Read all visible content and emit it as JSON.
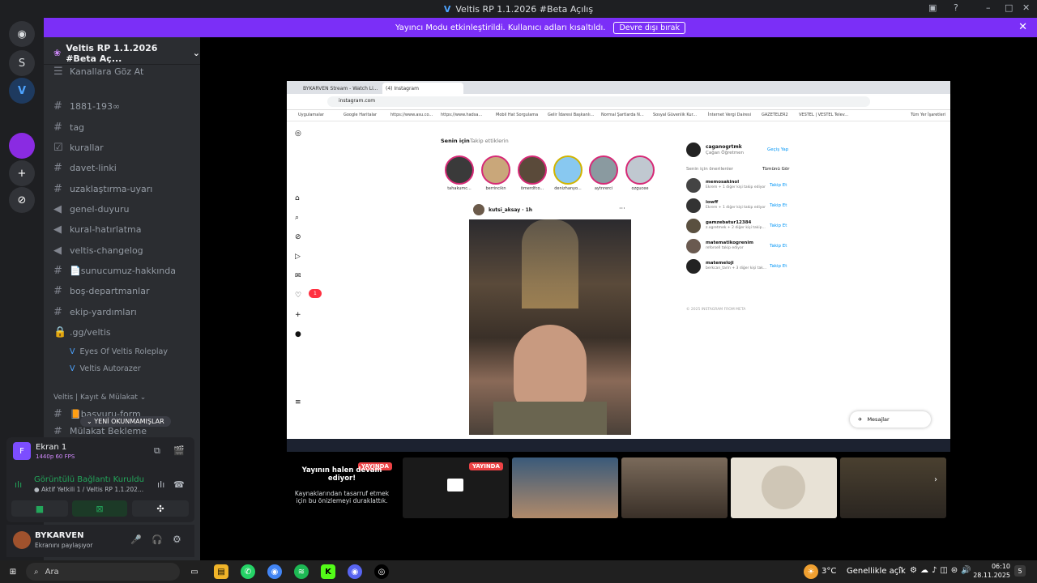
{
  "window": {
    "title": "Veltis RP 1.1.2026 #Beta Açılış"
  },
  "banner": {
    "text": "Yayıncı Modu etkinleştirildi. Kullanıcı adları kısaltıldı.",
    "button": "Devre dışı bırak"
  },
  "server": {
    "name": "Veltis RP 1.1.2026 #Beta Aç...",
    "browse": "Kanallara Göz At"
  },
  "channels": [
    "1881-193∞",
    "tag",
    "kurallar",
    "davet-linki",
    "uzaklaştırma-uyarı",
    "genel-duyuru",
    "kural-hatırlatma",
    "veltis-changelog",
    "📄sunucumuz-hakkında",
    "boş-departmanlar",
    "ekip-yardımları",
    ".gg/veltis"
  ],
  "threads": [
    "Eyes Of Veltis Roleplay",
    "Veltis Autorazer"
  ],
  "category": "Veltis | Kayıt & Mülakat",
  "cat_channels": [
    "📙başvuru-form",
    "Mülakat Bekleme"
  ],
  "unread_pill": "YENİ OKUNMAMIŞLAR",
  "screen": {
    "name": "Ekran 1",
    "quality": "1440p 60 FPS"
  },
  "voice": {
    "status": "Görüntülü Bağlantı Kuruldu",
    "channel": "Aktif Yetkili 1 / Veltis RP 1.1.202..."
  },
  "user": {
    "name": "BYKARVEN",
    "status": "Ekranını paylaşıyor"
  },
  "browser": {
    "tab1": "BYKARVEN Stream - Watch Li...",
    "tab2": "(4) Instagram",
    "url": "instagram.com",
    "bookmarks": [
      "Uygulamalar",
      "Google Haritalar",
      "https://www.asu.co...",
      "https://www.hadsa...",
      "Mobil Hat Sorgulama",
      "Gelir İdaresi Başkanlı...",
      "Normal Şartlarda N...",
      "Sosyal Güvenlik Kur...",
      "İnternet Vergi Dairesi",
      "GAZETELER2",
      "VESTEL | VESTEL Telev...",
      "Tüm Yer İşaretleri"
    ]
  },
  "instagram": {
    "tab_foryou": "Senin için",
    "tab_following": "Takip ettiklerin",
    "stories": [
      "tahakumc...",
      "berrincikn",
      "ömerdfco...",
      "denizhanyo...",
      "aytnrerci",
      "ozgucee"
    ],
    "post_user": "kutsi_aksay",
    "post_time": "1h",
    "me": {
      "name": "caganogrtmk",
      "sub": "Çağan Öğretmen",
      "action": "Geçiş Yap"
    },
    "suggest_title": "Senin için önerilenler",
    "suggest_all": "Tümünü Gör",
    "suggestions": [
      {
        "name": "memosakinol",
        "sub": "Ekrem + 1 diğer kişi takip ediyor"
      },
      {
        "name": "iowff",
        "sub": "Ekrem + 1 diğer kişi takip ediyor"
      },
      {
        "name": "gamzebatur12384",
        "sub": "z.ogretmek + 2 diğer kişi takip..."
      },
      {
        "name": "matematikogrenim",
        "sub": "reforsell takip ediyor"
      },
      {
        "name": "matemeloji",
        "sub": "berkcan_tarin + 3 diğer kişi tak..."
      }
    ],
    "follow": "Takip Et",
    "footer": "© 2025 INSTAGRAM FROM META",
    "messages": "Mesajlar",
    "notif": "1"
  },
  "paused": {
    "title": "Yayının halen devam ediyor!",
    "text": "Kaynaklarından tasarruf etmek için bu önizlemeyi duraklattık.",
    "live": "YAYINDA"
  },
  "taskbar": {
    "search": "Ara",
    "weather": "3°C",
    "weather_text": "Genellikle açık",
    "time": "06:10",
    "date": "28.11.2025",
    "notif": "5"
  }
}
